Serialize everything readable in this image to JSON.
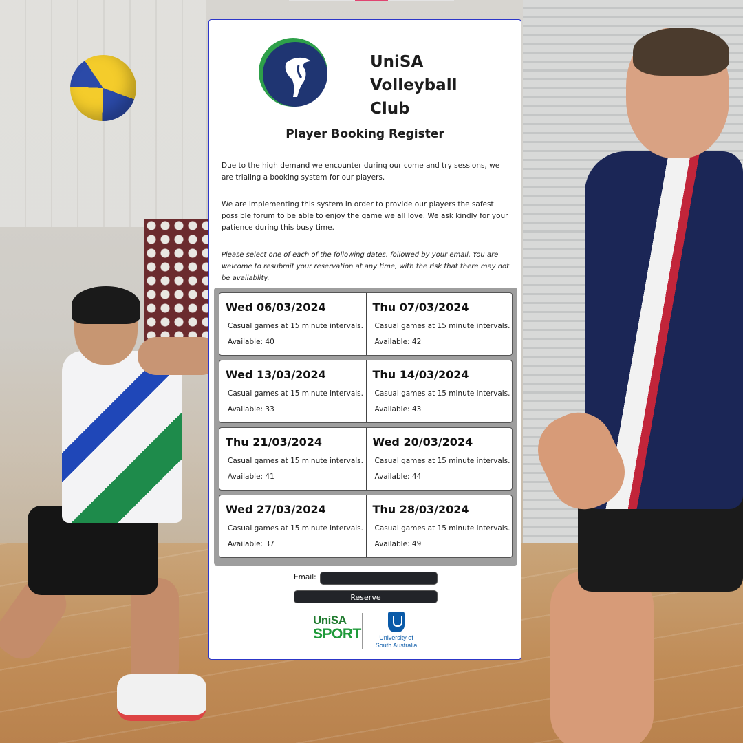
{
  "club": {
    "title_line1": "UniSA Volleyball",
    "title_line2": "Club",
    "logo_icon": "goat-head-icon",
    "brand_colors": {
      "green": "#2ea04a",
      "navy": "#1f3572"
    }
  },
  "page_title": "Player Booking Register",
  "intro": {
    "p1": "Due to the high demand we encounter during our come and try sessions, we are trialing a booking system for our players.",
    "p2": "We are implementing this system in order to provide our players the safest possible forum to be able to enjoy the game we all love. We ask kindly for your patience during this busy time.",
    "p3": "Please select one of each of the following dates, followed by your email. You are welcome to resubmit your reservation at any time, with the risk that there may not be availablity."
  },
  "sessions": [
    [
      {
        "date": "Wed 06/03/2024",
        "desc": "Casual games at 15 minute intervals.",
        "available": "Available: 40"
      },
      {
        "date": "Thu 07/03/2024",
        "desc": "Casual games at 15 minute intervals.",
        "available": "Available: 42"
      }
    ],
    [
      {
        "date": "Wed 13/03/2024",
        "desc": "Casual games at 15 minute intervals.",
        "available": "Available: 33"
      },
      {
        "date": "Thu 14/03/2024",
        "desc": "Casual games at 15 minute intervals.",
        "available": "Available: 43"
      }
    ],
    [
      {
        "date": "Thu 21/03/2024",
        "desc": "Casual games at 15 minute intervals.",
        "available": "Available: 41"
      },
      {
        "date": "Wed 20/03/2024",
        "desc": "Casual games at 15 minute intervals.",
        "available": "Available: 44"
      }
    ],
    [
      {
        "date": "Wed 27/03/2024",
        "desc": "Casual games at 15 minute intervals.",
        "available": "Available: 37"
      },
      {
        "date": "Thu 28/03/2024",
        "desc": "Casual games at 15 minute intervals.",
        "available": "Available: 49"
      }
    ]
  ],
  "form": {
    "email_label": "Email:",
    "email_value": "",
    "reserve_label": "Reserve"
  },
  "footer": {
    "sport_logo_line1": "UniSA",
    "sport_logo_line2": "SPORT",
    "unisa_logo_line1": "University of",
    "unisa_logo_line2": "South Australia"
  }
}
